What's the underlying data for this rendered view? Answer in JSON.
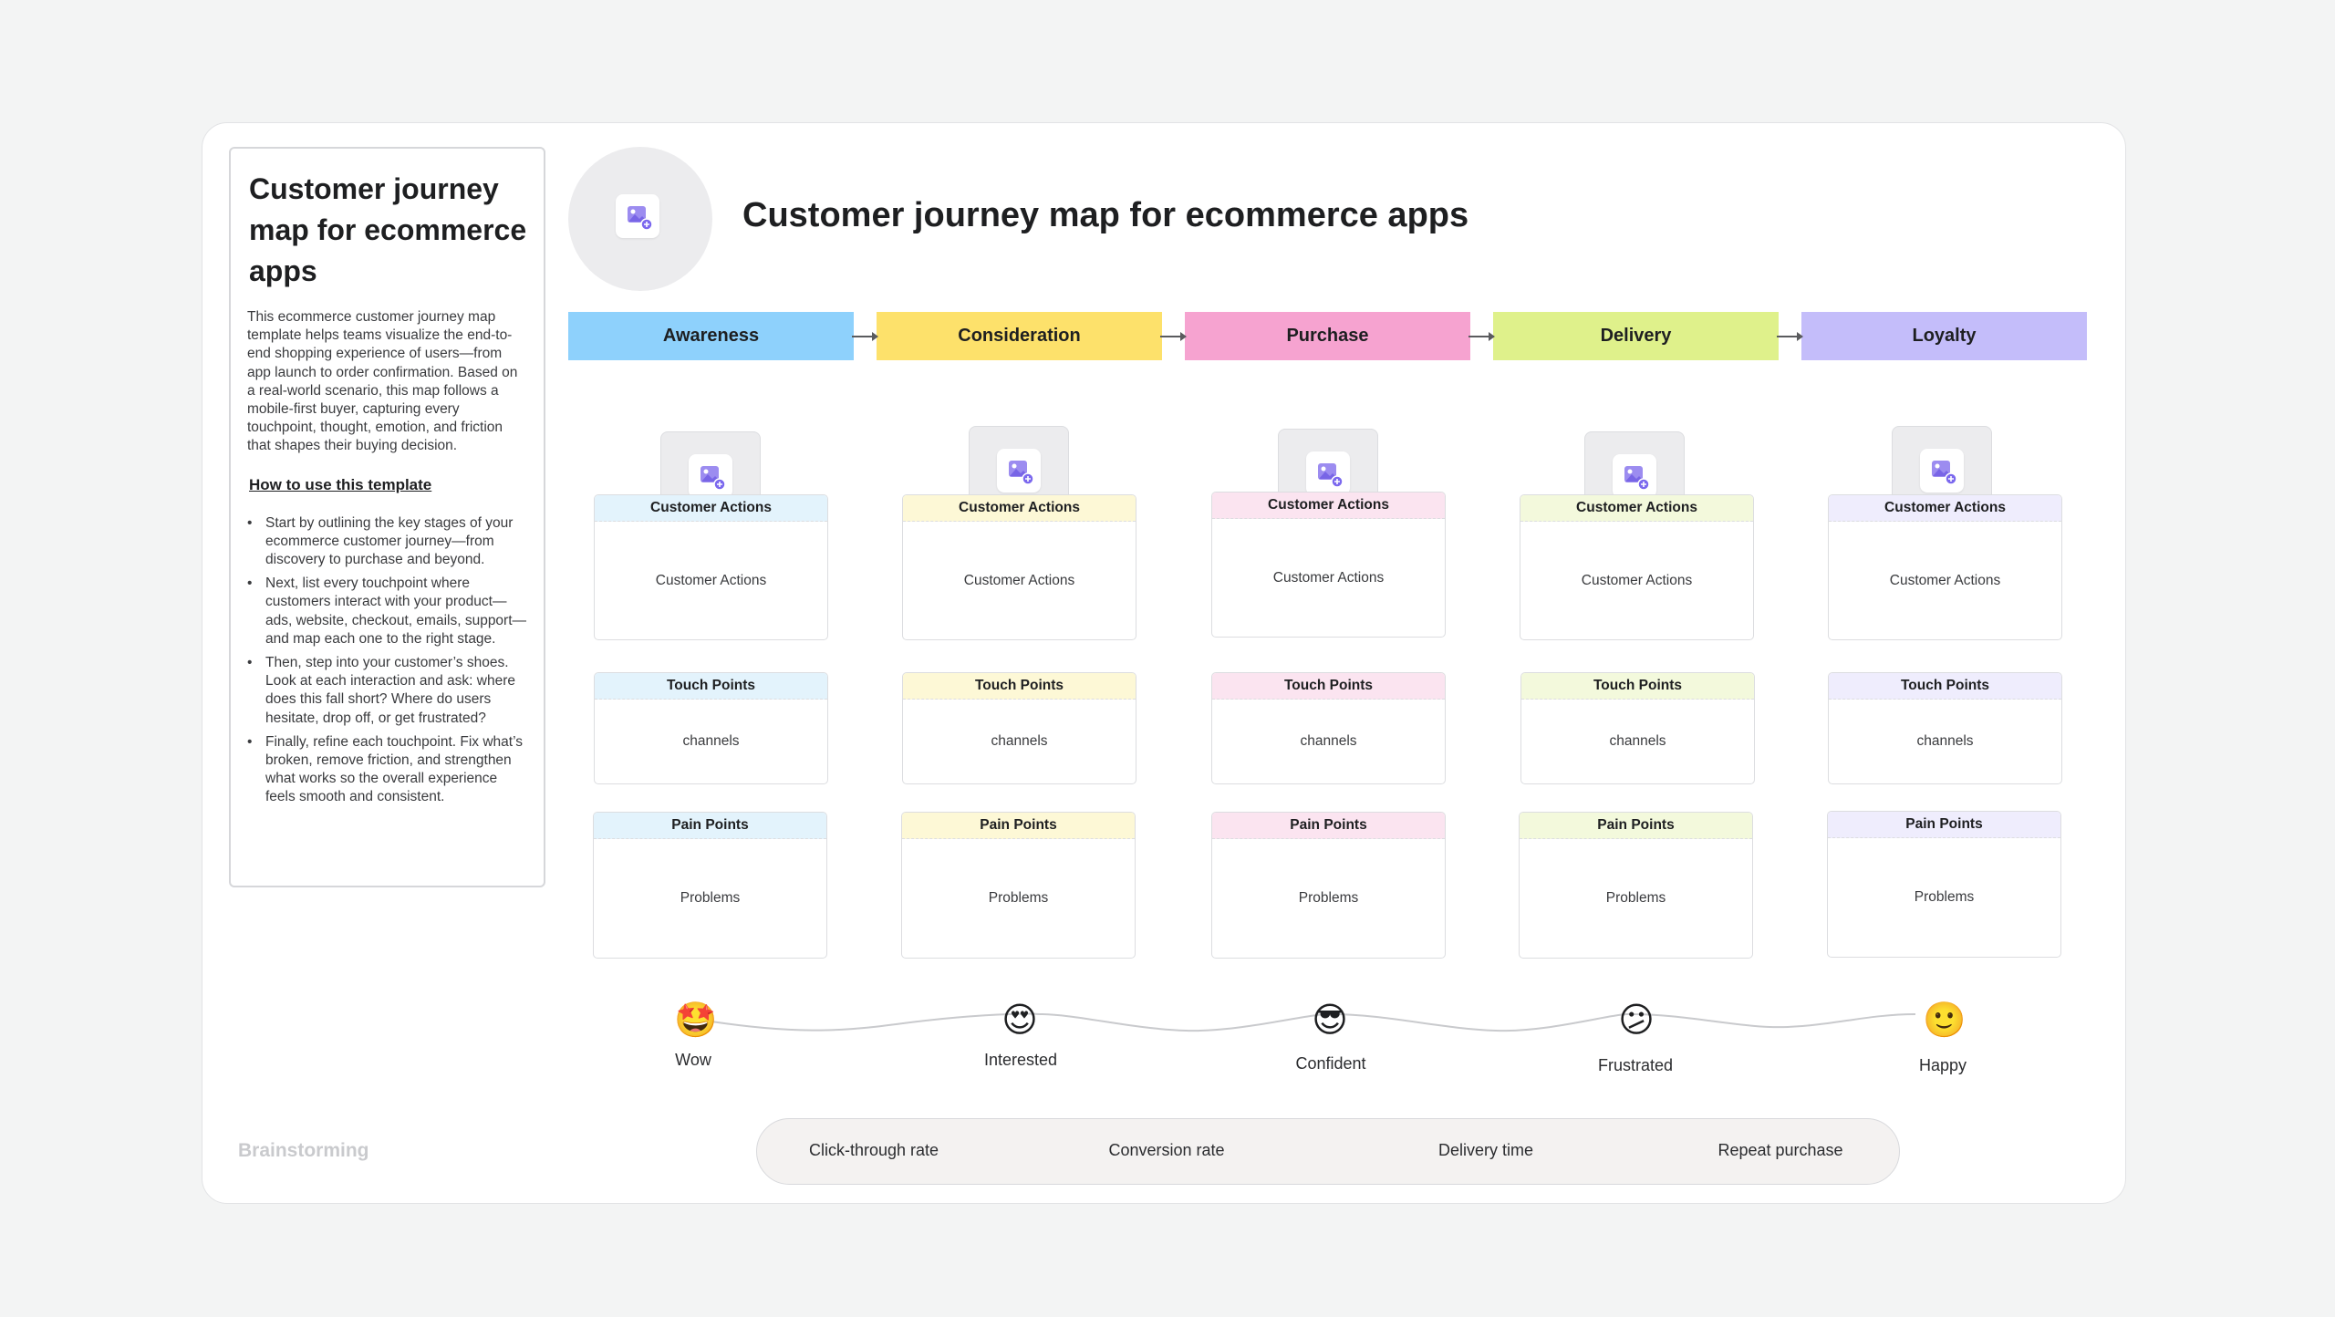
{
  "info": {
    "title": "Customer journey map for ecommerce apps",
    "description": "This ecommerce customer journey map template helps teams visualize the end-to-end shopping experience of users—from app launch to order confirmation. Based on a real-world scenario, this map follows a mobile-first buyer, capturing every touchpoint, thought, emotion, and friction that shapes their buying decision.",
    "howto_label": "How to use this template",
    "steps": [
      "Start by outlining the key stages of your ecommerce customer journey—from discovery to purchase and beyond.",
      "Next, list every touchpoint where customers interact with your product—ads, website, checkout, emails, support—and map each one to the right stage.",
      "Then, step into your customer’s shoes. Look at each interaction and ask: where does this fall short? Where do users hesitate, drop off, or get frustrated?",
      "Finally, refine each touchpoint. Fix what’s broken, remove friction, and strengthen what works so the overall experience feels smooth and consistent."
    ]
  },
  "brand": "Brainstorming",
  "map_title": "Customer journey map for ecommerce apps",
  "icons": {
    "image_placeholder": "image-add-icon",
    "arrow": "arrow-right-icon"
  },
  "stages": [
    {
      "name": "Awareness",
      "header_color": "#8ed1fc",
      "box_tint": "#e3f3fc",
      "actions_label": "Customer Actions",
      "actions_value": "Customer Actions",
      "touch_label": "Touch Points",
      "touch_value": "channels",
      "pain_label": "Pain Points",
      "pain_value": "Problems",
      "emoji": "🤩",
      "emotion": "Wow"
    },
    {
      "name": "Consideration",
      "header_color": "#fde16b",
      "box_tint": "#fdf8d6",
      "actions_label": "Customer Actions",
      "actions_value": "Customer Actions",
      "touch_label": "Touch Points",
      "touch_value": "channels",
      "pain_label": "Pain Points",
      "pain_value": "Problems",
      "emoji": "😍",
      "emotion": "Interested"
    },
    {
      "name": "Purchase",
      "header_color": "#f6a3d0",
      "box_tint": "#fbe4f0",
      "actions_label": "Customer Actions",
      "actions_value": "Customer Actions",
      "touch_label": "Touch Points",
      "touch_value": "channels",
      "pain_label": "Pain Points",
      "pain_value": "Problems",
      "emoji": "😎",
      "emotion": "Confident"
    },
    {
      "name": "Delivery",
      "header_color": "#dff18b",
      "box_tint": "#f3f9dc",
      "actions_label": "Customer Actions",
      "actions_value": "Customer Actions",
      "touch_label": "Touch Points",
      "touch_value": "channels",
      "pain_label": "Pain Points",
      "pain_value": "Problems",
      "emoji": "😕",
      "emotion": "Frustrated"
    },
    {
      "name": "Loyalty",
      "header_color": "#c4bdfa",
      "box_tint": "#efedfd",
      "actions_label": "Customer Actions",
      "actions_value": "Customer Actions",
      "touch_label": "Touch Points",
      "touch_value": "channels",
      "pain_label": "Pain Points",
      "pain_value": "Problems",
      "emoji": "🙂",
      "emotion": "Happy"
    }
  ],
  "metrics": [
    "Click-through rate",
    "Conversion rate",
    "Delivery time",
    "Repeat purchase"
  ]
}
